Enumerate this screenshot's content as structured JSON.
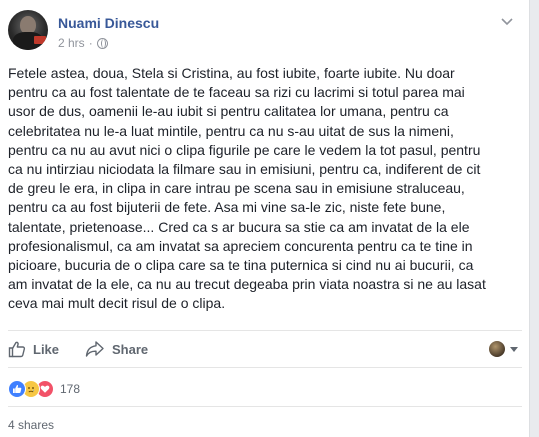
{
  "post": {
    "author": "Nuami Dinescu",
    "time": "2 hrs",
    "separator": "·",
    "privacy_icon": "globe-icon",
    "options_icon": "chevron-down-icon",
    "text": "Fetele astea, doua, Stela si Cristina, au fost iubite, foarte iubite. Nu doar\npentru ca au fost talentate de te faceau sa rizi cu lacrimi si totul parea mai\nusor de dus, oamenii le-au iubit si pentru calitatea lor umana, pentru ca\ncelebritatea nu le-a luat mintile, pentru ca nu s-au uitat de sus la nimeni,\npentru ca nu au avut nici o clipa figurile pe care le vedem la tot pasul, pentru\nca nu intirziau niciodata la filmare sau in emisiuni, pentru ca, indiferent de cit\nde greu le era, in clipa in care intrau pe scena sau in emisiune straluceau,\npentru ca au fost bijuterii de fete. Asa mi vine sa-le zic, niste fete bune,\ntalentate, prietenoase... Cred ca s ar bucura sa stie ca am invatat de la ele\nprofesionalismul, ca am invatat sa apreciem concurenta pentru ca te tine in\npicioare, bucuria de o clipa care sa te tina puternica si cind nu ai bucurii, ca\nam invatat de la ele, ca nu au trecut degeaba prin viata noastra si ne au lasat\nceva mai mult decit risul de o clipa."
  },
  "actions": {
    "like_label": "Like",
    "share_label": "Share"
  },
  "reactions": {
    "types": [
      "like",
      "sad",
      "love"
    ],
    "count": "178"
  },
  "shares": {
    "label": "4 shares"
  },
  "colors": {
    "author_link": "#385898",
    "meta_gray": "#90949c",
    "body_text": "#1d2129",
    "like_blue": "#4080ff",
    "love_red": "#f25268",
    "sad_yellow": "#f7c744"
  }
}
